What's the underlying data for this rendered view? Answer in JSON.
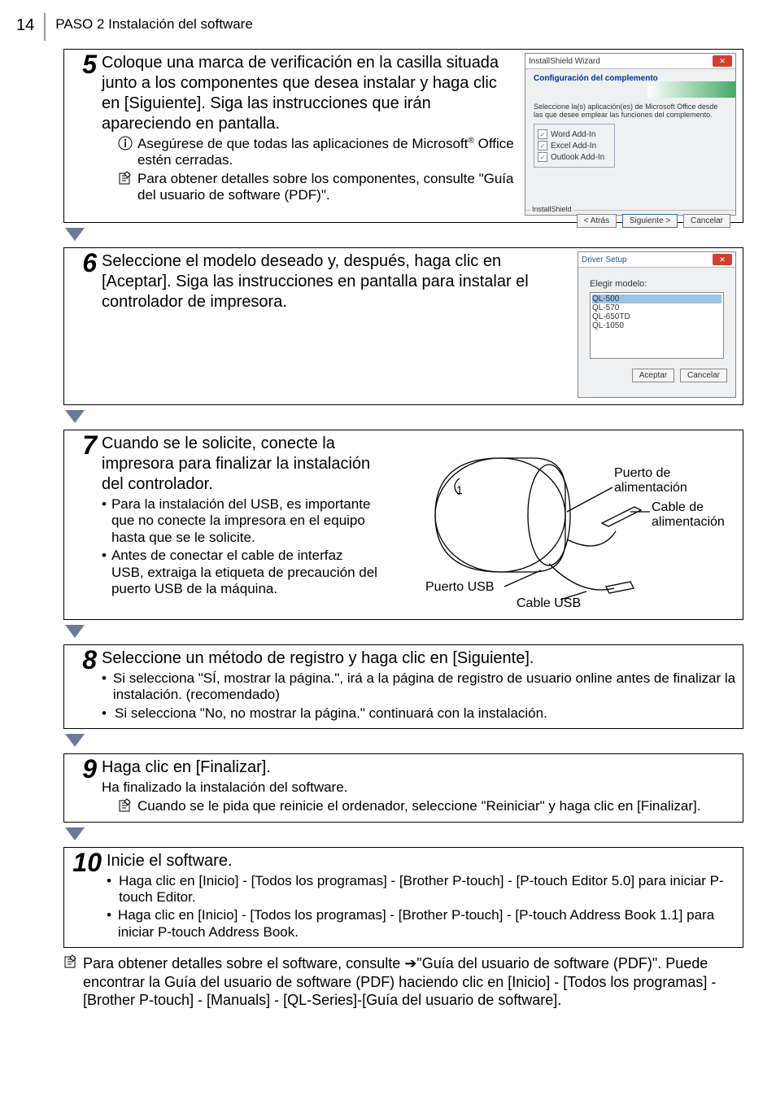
{
  "page_number": "14",
  "header": "PASO 2 Instalación del software",
  "step5": {
    "num": "5",
    "main": "Coloque una marca de verificación en la casilla situada junto a los componentes que desea instalar y haga clic en [Siguiente]. Siga las instrucciones que irán apareciendo en pantalla.",
    "warn": "Asegúrese de que todas las aplicaciones de Microsoft® Office estén cerradas.",
    "note": "Para obtener detalles sobre los componentes, consulte \"Guía del usuario de software (PDF)\".",
    "shot": {
      "title": "InstallShield Wizard",
      "heading": "Configuración del complemento",
      "desc": "Seleccione la(s) aplicación(es) de Microsoft Office desde las que desee emplear las funciones del complemento.",
      "items": [
        "Word Add-In",
        "Excel Add-In",
        "Outlook Add-In"
      ],
      "group": "InstallShield",
      "back": "< Atrás",
      "next": "Siguiente >",
      "cancel": "Cancelar"
    }
  },
  "step6": {
    "num": "6",
    "main": "Seleccione el modelo deseado y, después, haga clic en [Aceptar]. Siga las instrucciones en pantalla para instalar el controlador de impresora.",
    "shot": {
      "title": "Driver Setup",
      "label": "Elegir modelo:",
      "items": [
        "QL-500",
        "QL-570",
        "QL-650TD",
        "QL-1050"
      ],
      "ok": "Aceptar",
      "cancel": "Cancelar"
    }
  },
  "step7": {
    "num": "7",
    "main": "Cuando se le solicite, conecte la impresora para finalizar la instalación del controlador.",
    "b1": "Para la instalación del USB, es importante que no conecte la impresora en el equipo hasta que se le solicite.",
    "b2": "Antes de conectar el cable de interfaz USB, extraiga la etiqueta de precaución del puerto USB de la máquina.",
    "labels": {
      "power_port": "Puerto de alimentación",
      "power_cable": "Cable de alimentación",
      "usb_port": "Puerto USB",
      "usb_cable": "Cable USB"
    }
  },
  "step8": {
    "num": "8",
    "main": "Seleccione un método de registro y haga clic en [Siguiente].",
    "b1": "Si selecciona \"SÍ, mostrar la página.\", irá a la página de registro de usuario online antes de finalizar la instalación. (recomendado)",
    "b2": "Si selecciona \"No, no mostrar la página.\" continuará con la instalación."
  },
  "step9": {
    "num": "9",
    "main": "Haga clic en [Finalizar].",
    "sub1": "Ha finalizado la instalación del software.",
    "note": "Cuando se le pida que reinicie el ordenador, seleccione \"Reiniciar\" y haga clic en [Finalizar]."
  },
  "step10": {
    "num": "10",
    "main": "Inicie el software.",
    "b1": "Haga clic en [Inicio] - [Todos los programas] - [Brother P-touch] - [P-touch Editor 5.0] para iniciar P-touch Editor.",
    "b2": "Haga clic en [Inicio] - [Todos los programas] - [Brother P-touch] - [P-touch Address Book 1.1] para iniciar P-touch Address Book."
  },
  "footer": "Para obtener detalles sobre el software, consulte ➔\"Guía del usuario de software (PDF)\". Puede encontrar la Guía del usuario de software (PDF) haciendo clic en [Inicio] - [Todos los programas] - [Brother P-touch] - [Manuals] - [QL-Series]-[Guía del usuario de software]."
}
